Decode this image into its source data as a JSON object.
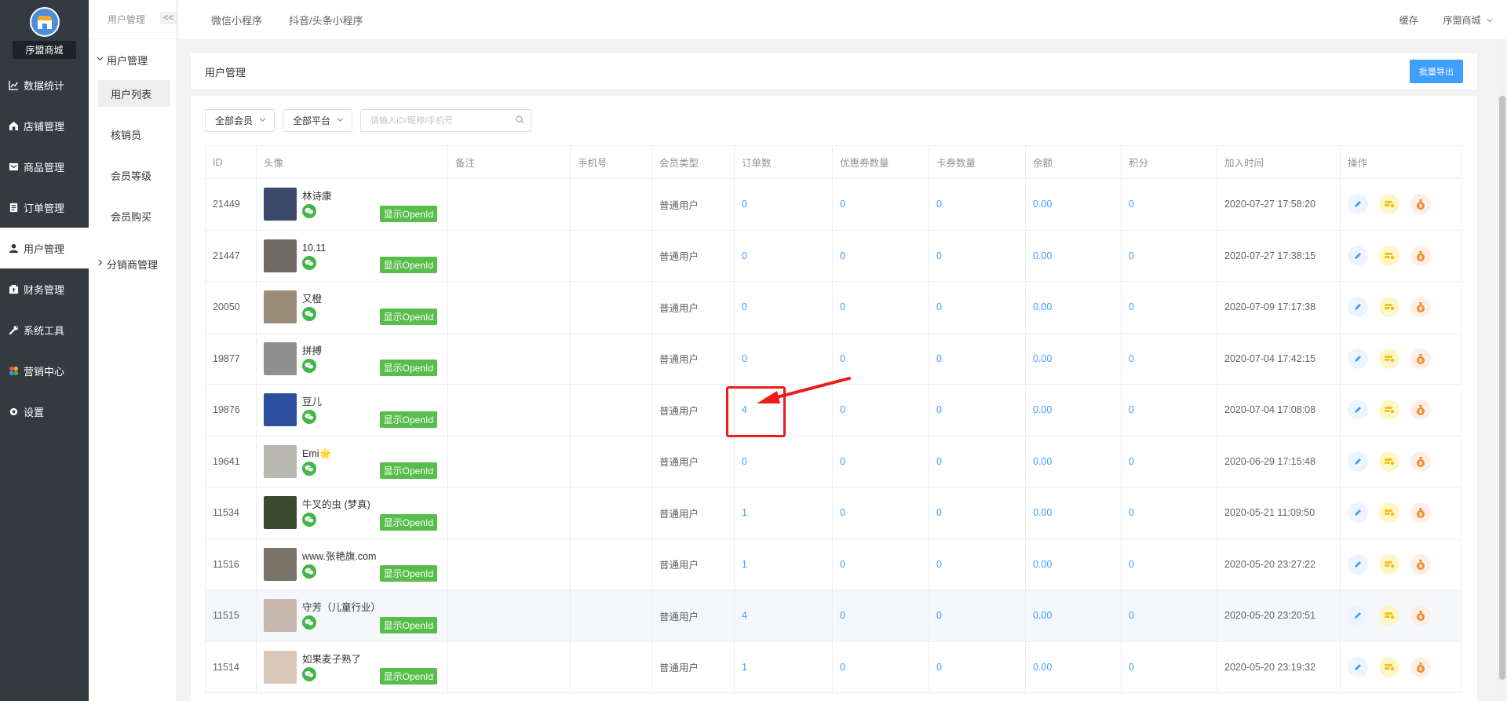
{
  "app": {
    "shop_name": "序盟商城"
  },
  "sidebar": {
    "items": [
      {
        "label": "数据统计",
        "icon": "chart-icon"
      },
      {
        "label": "店铺管理",
        "icon": "store-icon"
      },
      {
        "label": "商品管理",
        "icon": "goods-icon"
      },
      {
        "label": "订单管理",
        "icon": "order-icon"
      },
      {
        "label": "用户管理",
        "icon": "user-icon"
      },
      {
        "label": "财务管理",
        "icon": "finance-icon"
      },
      {
        "label": "系统工具",
        "icon": "wrench-icon"
      },
      {
        "label": "营销中心",
        "icon": "marketing-icon"
      },
      {
        "label": "设置",
        "icon": "gear-icon"
      }
    ],
    "active_index": 4
  },
  "subsidebar": {
    "header": "用户管理",
    "collapse": "<<",
    "group1": "用户管理",
    "items": [
      "用户列表",
      "核销员",
      "会员等级",
      "会员购买"
    ],
    "group2": "分销商管理"
  },
  "topbar": {
    "tabs": [
      "微信小程序",
      "抖音/头条小程序"
    ],
    "cache": "缓存",
    "user": "序盟商城"
  },
  "page": {
    "title": "用户管理",
    "export_label": "批量导出"
  },
  "filters": {
    "member": "全部会员",
    "platform": "全部平台",
    "search_placeholder": "请输入ID/昵称/手机号"
  },
  "table": {
    "headers": [
      "ID",
      "头像",
      "备注",
      "手机号",
      "会员类型",
      "订单数",
      "优惠券数量",
      "卡券数量",
      "余额",
      "积分",
      "加入时间",
      "操作"
    ],
    "openid_label": "显示OpenId",
    "rows": [
      {
        "id": "21449",
        "name": "林诗康",
        "remark": "",
        "phone": "",
        "type": "普通用户",
        "orders": "0",
        "coupons": "0",
        "cards": "0",
        "balance": "0.00",
        "points": "0",
        "joined": "2020-07-27 17:58:20",
        "avatar_color": "#3b4a6b"
      },
      {
        "id": "21447",
        "name": "10.11",
        "remark": "",
        "phone": "",
        "type": "普通用户",
        "orders": "0",
        "coupons": "0",
        "cards": "0",
        "balance": "0.00",
        "points": "0",
        "joined": "2020-07-27 17:38:15",
        "avatar_color": "#6e6a66"
      },
      {
        "id": "20050",
        "name": "又橙",
        "remark": "",
        "phone": "",
        "type": "普通用户",
        "orders": "0",
        "coupons": "0",
        "cards": "0",
        "balance": "0.00",
        "points": "0",
        "joined": "2020-07-09 17:17:38",
        "avatar_color": "#9c8c7a"
      },
      {
        "id": "19877",
        "name": "拼搏",
        "remark": "",
        "phone": "",
        "type": "普通用户",
        "orders": "0",
        "coupons": "0",
        "cards": "0",
        "balance": "0.00",
        "points": "0",
        "joined": "2020-07-04 17:42:15",
        "avatar_color": "#8f8f8f"
      },
      {
        "id": "19876",
        "name": "豆儿",
        "remark": "",
        "phone": "",
        "type": "普通用户",
        "orders": "4",
        "coupons": "0",
        "cards": "0",
        "balance": "0.00",
        "points": "0",
        "joined": "2020-07-04 17:08:08",
        "avatar_color": "#2d4f9e"
      },
      {
        "id": "19641",
        "name": "Emi🌟",
        "remark": "",
        "phone": "",
        "type": "普通用户",
        "orders": "0",
        "coupons": "0",
        "cards": "0",
        "balance": "0.00",
        "points": "0",
        "joined": "2020-06-29 17:15:48",
        "avatar_color": "#b8b8b0"
      },
      {
        "id": "11534",
        "name": "牛叉的虫 (梦真)",
        "remark": "",
        "phone": "",
        "type": "普通用户",
        "orders": "1",
        "coupons": "0",
        "cards": "0",
        "balance": "0.00",
        "points": "0",
        "joined": "2020-05-21 11:09:50",
        "avatar_color": "#3a4a2e"
      },
      {
        "id": "11516",
        "name": "www.张艳旗.com",
        "remark": "",
        "phone": "",
        "type": "普通用户",
        "orders": "1",
        "coupons": "0",
        "cards": "0",
        "balance": "0.00",
        "points": "0",
        "joined": "2020-05-20 23:27:22",
        "avatar_color": "#7a7468"
      },
      {
        "id": "11515",
        "name": "守芳（儿童行业）",
        "remark": "",
        "phone": "",
        "type": "普通用户",
        "orders": "4",
        "coupons": "0",
        "cards": "0",
        "balance": "0.00",
        "points": "0",
        "joined": "2020-05-20 23:20:51",
        "avatar_color": "#c9b8b0"
      },
      {
        "id": "11514",
        "name": "如果麦子熟了",
        "remark": "",
        "phone": "",
        "type": "普通用户",
        "orders": "1",
        "coupons": "0",
        "cards": "0",
        "balance": "0.00",
        "points": "0",
        "joined": "2020-05-20 23:19:32",
        "avatar_color": "#d9c7b8"
      }
    ],
    "highlight_row_index": 8
  },
  "colors": {
    "accent": "#409eff",
    "sidebar_bg": "#333a40",
    "wechat": "#44b549",
    "annotation": "#ee1b1b"
  }
}
